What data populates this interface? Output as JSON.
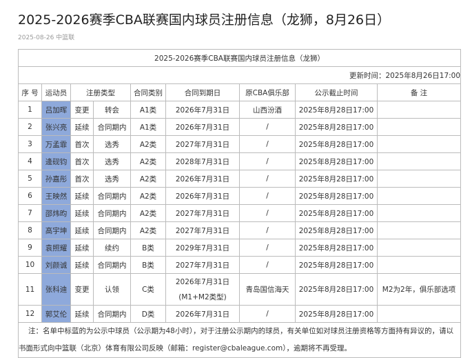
{
  "title": "2025-2026赛季CBA联赛国内球员注册信息（龙狮，8月26日）",
  "meta": "2025-08-26 中篮联",
  "table": {
    "caption": "2025-2026赛季CBA联赛国内球员注册信息（龙狮）",
    "updated": "更新时间：2025年8月26日17:00",
    "headers": [
      "序 号",
      "运动员",
      "注册类型",
      "合同类别",
      "合同到期日",
      "原CBA俱乐部",
      "公示截止时间",
      "备 注"
    ],
    "rows": [
      [
        "1",
        "吕加晖",
        "变更",
        "转会",
        "A1类",
        "2026年7月31日",
        "山西汾酒",
        "2025年8月28日17:00",
        ""
      ],
      [
        "2",
        "张兴亮",
        "延续",
        "合同期内",
        "A1类",
        "2026年7月31日",
        "/",
        "2025年8月28日17:00",
        ""
      ],
      [
        "3",
        "万孟霏",
        "首次",
        "选秀",
        "A2类",
        "2027年7月31日",
        "/",
        "2025年8月28日17:00",
        ""
      ],
      [
        "4",
        "逄砚钧",
        "首次",
        "选秀",
        "A2类",
        "2028年7月31日",
        "/",
        "2025年8月28日17:00",
        ""
      ],
      [
        "5",
        "孙嘉彤",
        "首次",
        "选秀",
        "A2类",
        "2026年7月31日",
        "/",
        "2025年8月28日17:00",
        ""
      ],
      [
        "6",
        "王映然",
        "延续",
        "合同期内",
        "A2类",
        "2026年7月31日",
        "/",
        "2025年8月28日17:00",
        ""
      ],
      [
        "7",
        "邵炜昀",
        "延续",
        "合同期内",
        "A2类",
        "2027年7月31日",
        "/",
        "2025年8月28日17:00",
        ""
      ],
      [
        "8",
        "高宇坤",
        "延续",
        "合同期内",
        "A2类",
        "2027年7月31日",
        "/",
        "2025年8月28日17:00",
        ""
      ],
      [
        "9",
        "袁照耀",
        "延续",
        "续约",
        "B类",
        "2029年7月31日",
        "/",
        "2025年8月28日17:00",
        ""
      ],
      [
        "10",
        "刘颜诚",
        "延续",
        "合同期内",
        "B类",
        "2027年7月31日",
        "/",
        "2025年8月28日17:00",
        ""
      ],
      [
        "11",
        "张科迪",
        "变更",
        "认领",
        "C类",
        "2026年7月31日",
        "青岛国信海天",
        "2025年8月28日17:00",
        "M2为2年，俱乐部选项"
      ],
      [
        "12",
        "郭艾伦",
        "延续",
        "合同期内",
        "D类",
        "2026年7月31日",
        "/",
        "2025年8月28日17:00",
        ""
      ]
    ],
    "row11_date_extra": "(M1+M2类型)",
    "note": "注：名单中标蓝的为公示中球员（公示期为48小时），对于注册公示期内的球员，有关单位如对球员注册资格等方面持有异议的，请以书面形式向中篮联（北京）体育有限公司反映（邮箱：register@cbaleague.com），逾期将不再受理。"
  },
  "colors": {
    "highlight": "#8ea9db"
  }
}
